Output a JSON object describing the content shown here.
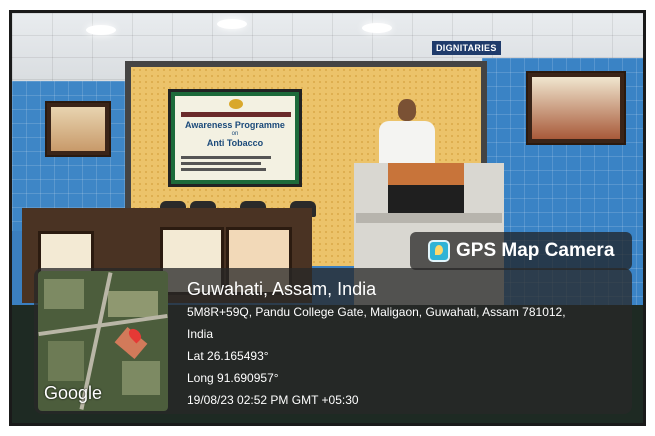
{
  "sign": {
    "dignitaries": "DIGNITARIES"
  },
  "slide": {
    "line1": "Awareness Programme",
    "line2": "on",
    "line3": "Anti Tobacco"
  },
  "overlay": {
    "app_name": "GPS Map Camera",
    "map_label": "Google",
    "city": "Guwahati, Assam, India",
    "address_line1": "5M8R+59Q, Pandu College Gate, Maligaon, Guwahati, Assam 781012,",
    "address_line2": "India",
    "latitude": "Lat 26.165493°",
    "longitude": "Long 91.690957°",
    "timestamp": "19/08/23 02:52 PM GMT +05:30"
  },
  "icons": {
    "app": "gps-camera-icon",
    "pin": "map-pin-icon"
  },
  "colors": {
    "overlay_bg": "#282828",
    "pin": "#e53935",
    "wall": "#3a83c5"
  }
}
